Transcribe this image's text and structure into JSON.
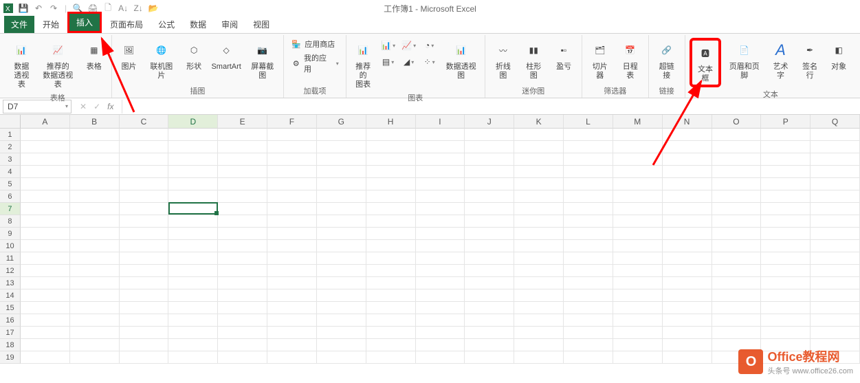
{
  "title": "工作簿1 - Microsoft Excel",
  "tabs": {
    "file": "文件",
    "items": [
      "开始",
      "插入",
      "页面布局",
      "公式",
      "数据",
      "审阅",
      "视图"
    ],
    "active": "插入"
  },
  "ribbon": {
    "tables": {
      "label": "表格",
      "pivot": "数据\n透视表",
      "rec": "推荐的\n数据透视表",
      "table": "表格"
    },
    "illus": {
      "label": "插图",
      "pic": "图片",
      "online": "联机图片",
      "shapes": "形状",
      "smartart": "SmartArt",
      "screenshot": "屏幕截图"
    },
    "addins": {
      "label": "加载项",
      "store": "应用商店",
      "myapps": "我的应用"
    },
    "charts": {
      "label": "图表",
      "rec": "推荐的\n图表",
      "pivotchart": "数据透视图"
    },
    "spark": {
      "label": "迷你图",
      "line": "折线图",
      "col": "柱形图",
      "winloss": "盈亏"
    },
    "filter": {
      "label": "筛选器",
      "slicer": "切片器",
      "timeline": "日程表"
    },
    "links": {
      "label": "链接",
      "hyper": "超链接"
    },
    "text": {
      "label": "文本",
      "textbox": "文本框",
      "hf": "页眉和页脚",
      "wordart": "艺术字",
      "sig": "签名行",
      "obj": "对象"
    }
  },
  "namebox": "D7",
  "columns": [
    "A",
    "B",
    "C",
    "D",
    "E",
    "F",
    "G",
    "H",
    "I",
    "J",
    "K",
    "L",
    "M",
    "N",
    "O",
    "P",
    "Q"
  ],
  "rows": [
    1,
    2,
    3,
    4,
    5,
    6,
    7,
    8,
    9,
    10,
    11,
    12,
    13,
    14,
    15,
    16,
    17,
    18,
    19
  ],
  "active_cell": {
    "col": "D",
    "row": 7
  },
  "watermark": {
    "l1": "Office教程网",
    "l2": "头条号 www.office26.com"
  }
}
